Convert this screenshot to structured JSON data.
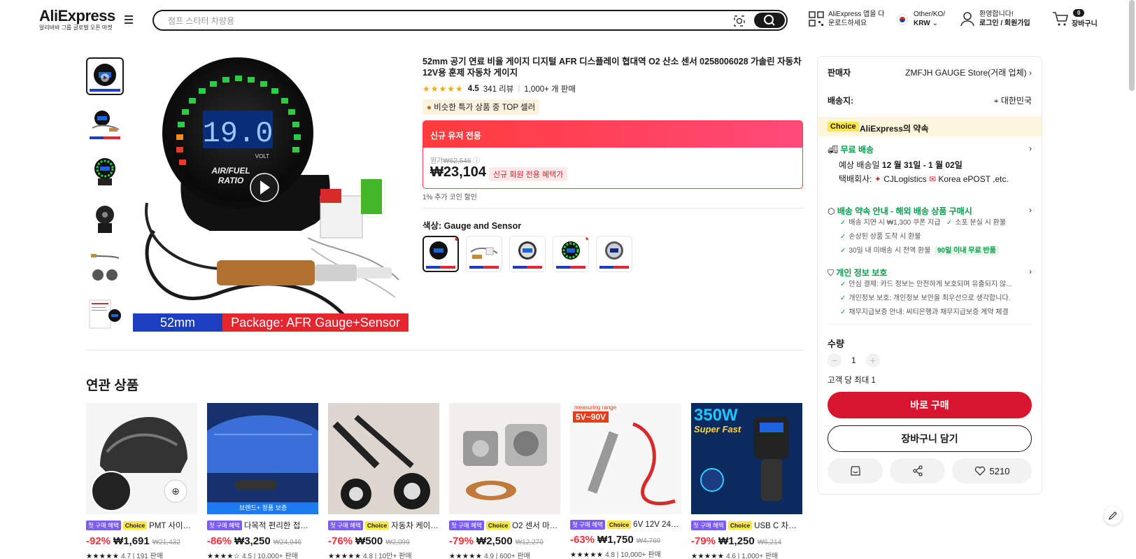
{
  "header": {
    "logo": "AliExpress",
    "logo_sub": "알리바바 그룹 글로벌 오픈 마켓",
    "search_placeholder": "점프 스타터 차량용",
    "app_line1": "AliExpress 앱을 다",
    "app_line2": "운로드하세요",
    "region_line1": "Other/KO/",
    "region_line2": "KRW",
    "account_line1": "환영합니다!",
    "account_line2": "로그인 / 회원가입",
    "cart_count": "0",
    "cart_label": "장바구니"
  },
  "product": {
    "title": "52mm 공기 연료 비율 게이지 디지털 AFR 디스플레이 협대역 O2 산소 센서 0258006028 가솔린 자동차 12V용 훈제 자동차 게이지",
    "rating": "4.5",
    "reviews": "341 리뷰",
    "sold": "1,000+ 개 판매",
    "top_badge": "비슷한 특가 상품 중 TOP 셀러",
    "gauge_reading": "19.0",
    "gauge_unit": "VOLT",
    "gauge_label1": "AIR/FUEL",
    "gauge_label2": "RATIO",
    "pkg_size": "52mm",
    "pkg_text": "Package: AFR Gauge+Sensor",
    "promo_header": "신규 유저 전용",
    "orig_label": "원가",
    "orig_price": "₩62,546",
    "price": "₩23,104",
    "price_tag": "신규 회원 전용 혜택가",
    "coin_text": "1% 추가 코인 할인",
    "color_label": "색상: Gauge and Sensor"
  },
  "related": {
    "title": "연관 상품",
    "items": [
      {
        "tag_first": "첫 구매 혜택",
        "tag_choice": "Choice",
        "name": "PMT 사이…",
        "disc": "-92%",
        "price": "₩1,691",
        "was": "₩21,432",
        "stars": "★★★★★",
        "rating": "4.7",
        "sold": "191 판매",
        "color": "#2b2b2b"
      },
      {
        "tag_first": "첫 구매 혜택",
        "tag_choice": "",
        "name": "다목적 편리한 접…",
        "disc": "-86%",
        "price": "₩3,250",
        "was": "₩24,946",
        "stars": "★★★★☆",
        "rating": "4.5",
        "sold": "10,000+ 판매",
        "color": "#17306e",
        "banner": "브랜드+ 정품 보증"
      },
      {
        "tag_first": "첫 구매 혜택",
        "tag_choice": "Choice",
        "name": "자동차 케이…",
        "disc": "-76%",
        "price": "₩500",
        "was": "₩2,099",
        "stars": "★★★★★",
        "rating": "4.8",
        "sold": "10만+ 판매",
        "color": "#d9d4cf"
      },
      {
        "tag_first": "첫 구매 혜택",
        "tag_choice": "Choice",
        "name": "O2 센서 마…",
        "disc": "-79%",
        "price": "₩2,500",
        "was": "₩12,270",
        "stars": "★★★★★",
        "rating": "4.9",
        "sold": "600+ 판매",
        "color": "#f1efec"
      },
      {
        "tag_first": "첫 구매 혜택",
        "tag_choice": "Choice",
        "name": "6V 12V 24…",
        "disc": "-63%",
        "price": "₩1,750",
        "was": "₩4,769",
        "stars": "★★★★★",
        "rating": "4.8",
        "sold": "10,000+ 판매",
        "color": "#f7f7f7",
        "overlay": "5V~90V",
        "overlay_top": "measuring range"
      },
      {
        "tag_first": "첫 구매 혜택",
        "tag_choice": "Choice",
        "name": "USB C 차…",
        "disc": "-79%",
        "price": "₩1,250",
        "was": "₩6,214",
        "stars": "★★★★★",
        "rating": "4.6",
        "sold": "1,000+ 판매",
        "color": "#0b2a5e",
        "overlay": "350W",
        "overlay_top": "Super Fast"
      }
    ]
  },
  "panel": {
    "seller_label": "판매자",
    "seller_name": "ZMFJH GAUGE Store(거래 업체)",
    "ship_to_label": "배송지:",
    "ship_to": "대한민국",
    "choice_chip": "Choice",
    "choice_text": "AliExpress의 약속",
    "free_shipping": "무료 배송",
    "eta_prefix": "예상 배송일",
    "eta_date": "12 월 31일 - 1 월 02일",
    "carrier_prefix": "택배회사:",
    "carrier1": "CJLogistics",
    "carrier2": "Korea ePOST ,etc.",
    "delivery_promise": "배송 약속 안내 - 해외 배송 상품 구매시",
    "promise1": "배송 지연 시 ₩1,300 쿠폰 지급",
    "promise2": "소포 분실 시 환불",
    "promise3": "손상된 상품 도착 시 환불",
    "promise4": "30일 내 미배송 시 전액 환불",
    "promise4_chip": "90일 이내 무료 반품",
    "privacy": "개인 정보 보호",
    "privacy1": "안심 결제: 카드 정보는 안전하게 보호되며 유출되지 않...",
    "privacy2": "개인정보 보호: 개인정보 보안을 최우선으로 생각합니다.",
    "privacy3": "채무지급보증 안내: 씨티은행과 채무지급보증 계약 체결",
    "qty_label": "수량",
    "qty_value": "1",
    "max_per": "고객 당 최대 1",
    "buy_now": "바로 구매",
    "add_cart": "장바구니 담기",
    "wish_count": "5210"
  },
  "colors": {
    "accent_red": "#d8152f",
    "choice_yellow": "#ffe74a",
    "green": "#00a04b"
  }
}
